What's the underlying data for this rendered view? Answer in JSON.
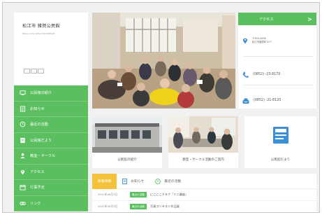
{
  "site": {
    "title": "松江市 雑賀公民館",
    "subtitle": "Matsue city SAIKA KOUMINKAN"
  },
  "sidebar": {
    "items": [
      {
        "label": "公民館の紹介",
        "icon": "monitor-icon"
      },
      {
        "label": "お知らせ",
        "icon": "list-icon"
      },
      {
        "label": "最近の活動",
        "icon": "clock-icon"
      },
      {
        "label": "公民館だより",
        "icon": "newsletter-icon"
      },
      {
        "label": "教室・サークル",
        "icon": "circle-group-icon"
      },
      {
        "label": "アクセス",
        "icon": "location-pin-icon"
      },
      {
        "label": "行事予定",
        "icon": "calendar-icon"
      },
      {
        "label": "リンク",
        "icon": "link-icon"
      }
    ]
  },
  "access": {
    "label": "アクセス",
    "arrow": ">",
    "postal": "〒690-0056",
    "address": "松江市雑賀町 677",
    "tel": "(0852) -23-8179",
    "fax": "(0852) -21-8120"
  },
  "tiles": [
    {
      "label": "公民館の紹介"
    },
    {
      "label": "教室・サークル活動のご案内"
    },
    {
      "label": "公民館だより"
    }
  ],
  "news": {
    "tabs": [
      {
        "label": "新着情報",
        "icon": ""
      },
      {
        "label": "お知らせ",
        "icon": "list-icon"
      },
      {
        "label": "最近の活動",
        "icon": "clock-icon"
      }
    ],
    "items": [
      {
        "date": "2021年09月7日",
        "badge": "最近の活動",
        "title": "にこにこクラブ「ミニ講座」"
      },
      {
        "date": "2021年09月3日",
        "badge": "最近の活動",
        "title": "写真コンテスト作品展"
      }
    ]
  },
  "colors": {
    "accent": "#5bbf5f",
    "tab_active": "#f3c23a"
  }
}
